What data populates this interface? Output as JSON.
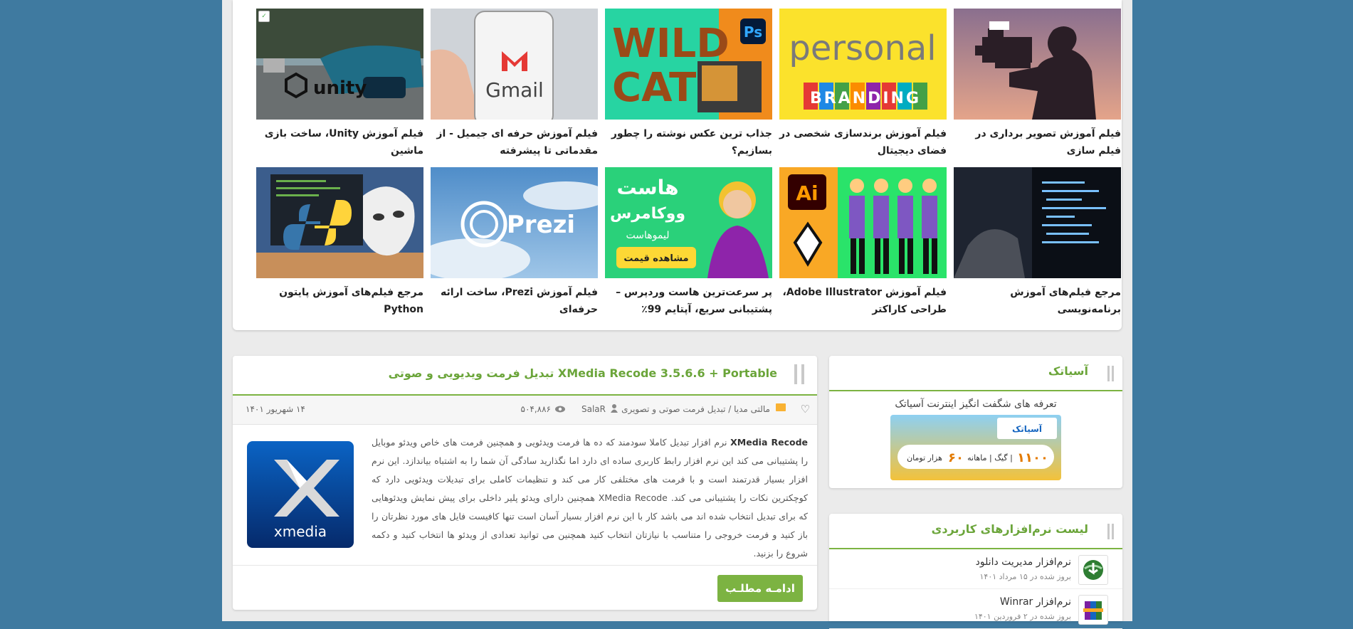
{
  "gallery": [
    {
      "caption": "فیلم آموزش تصویر برداری در فیلم سازی",
      "icon": "camera-operator-image"
    },
    {
      "caption": "فیلم آموزش برندسازی شخصی در فضای دیجیتال",
      "icon": "personal-branding-image",
      "img_text_1": "personal",
      "img_text_2": "BRANDING"
    },
    {
      "caption": "جذاب ترین عکس نوشته را چطور بسازیم؟",
      "icon": "wildcat-photoshop-image",
      "img_text_1": "WILD",
      "img_text_2": "CAT",
      "img_text_3": "Ps"
    },
    {
      "caption": "فیلم آموزش حرفه ای جیمیل - از مقدماتی تا پیشرفته",
      "icon": "gmail-phone-image",
      "img_text_1": "Gmail"
    },
    {
      "caption": "فیلم آموزش Unity، ساخت بازی ماشین",
      "icon": "unity-car-image",
      "img_text_1": "unity"
    },
    {
      "caption": "مرجع فیلم‌های آموزش برنامه‌نویسی",
      "icon": "programming-screen-image"
    },
    {
      "caption": "فیلم آموزش Adobe Illustrator، طراحی کاراکتر",
      "icon": "illustrator-character-image",
      "img_text_1": "Ai"
    },
    {
      "caption": "پر سرعت‌ترین هاست وردپرس – پشتیبانی سریع، آپتایم 99٪",
      "icon": "woocommerce-host-ad-image",
      "img_text_1": "هاست",
      "img_text_2": "ووکامرس",
      "img_text_3": "لیموهاست",
      "img_text_4": "مشاهده قیمت"
    },
    {
      "caption": "فیلم آموزش Prezi، ساخت ارائه حرفه‌ای",
      "icon": "prezi-sky-image",
      "img_text_1": "Prezi"
    },
    {
      "caption": "مرجع فیلم‌های آموزش پایتون Python",
      "icon": "python-mask-image"
    }
  ],
  "asiatech": {
    "title": "آسیاتک",
    "subtitle": "تعرفه های شگفت انگیز اینترنت آسیاتک",
    "banner_logo": "آسیاتک",
    "banner_text_1": "۱۱۰۰",
    "banner_text_2": "گیگ | ماهانه |",
    "banner_text_3": "۶۰",
    "banner_text_4": "هزار تومان"
  },
  "apps": {
    "title": "لیست نرم‌افزارهای کاربردی",
    "items": [
      {
        "name": "نرم‌افزار مدیریت دانلود",
        "date": "بروز شده در ۱۵ مرداد ۱۴۰۱",
        "icon": "idm-globe-icon"
      },
      {
        "name": "نرم‌افزار Winrar",
        "date": "بروز شده در ۲ فروردین ۱۴۰۱",
        "icon": "winrar-books-icon"
      }
    ]
  },
  "post": {
    "title": "XMedia Recode 3.5.6.6 + Portable تبدیل فرمت ویدیویی و صوتی",
    "category": "مالتی مدیا / تبدیل فرمت صوتی و تصویری",
    "author": "SalaR",
    "views": "۵۰۴,۸۸۶",
    "date": "۱۴ شهریور ۱۴۰۱",
    "body_bold": "XMedia Recode",
    "body": " نرم افزار تبدیل کاملا سودمند که ده ها فرمت ویدئویی و همچنین فرمت های خاص ویدئو موبایل را پشتیبانی می کند این نرم افزار رابط کاربری ساده ای دارد اما نگذارید سادگی آن شما را به اشتباه بیاندازد. این نرم افزار بسیار قدرتمند است و با فرمت های مختلفی کار می کند و تنظیمات کاملی برای تبدیلات ویدئویی دارد که کوچکترین نکات را پشتیبانی می کند. XMedia Recode همچنین دارای ویدئو پلیر داخلی برای پیش نمایش ویدئوهایی که برای تبدیل انتخاب شده اند می باشد کار با این نرم افزار بسیار آسان است تنها کافیست فایل های مورد نظرتان را باز کنید و فرمت خروجی را متناسب با نیازتان انتخاب کنید همچنین می توانید تعدادی از ویدئو ها انتخاب کنید و دکمه شروع را بزنید.",
    "logo_text": "xmedia",
    "more_label": "ادامـه مطلـب"
  },
  "colors": {
    "accent": "#7cb342",
    "accent_text": "#6ba53a",
    "background": "#3f7aa0"
  }
}
